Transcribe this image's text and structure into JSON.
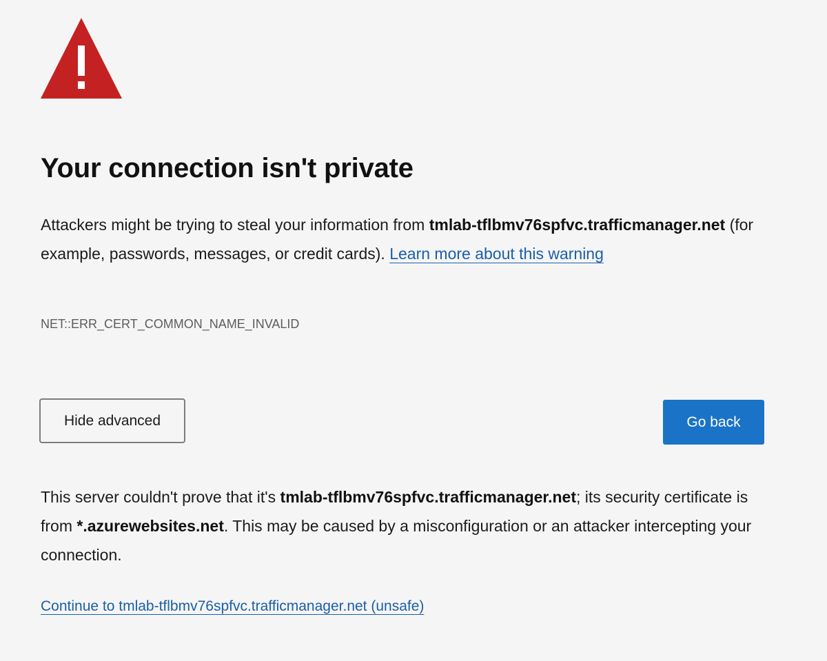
{
  "colors": {
    "background": "#f5f5f5",
    "warning_red": "#c42222",
    "link_blue": "#1a5fa8",
    "primary_button": "#1a73c7"
  },
  "icon": {
    "name": "warning-triangle-icon"
  },
  "title": "Your connection isn't private",
  "description": {
    "prefix": "Attackers might be trying to steal your information from ",
    "host": "tmlab-tflbmv76spfvc.trafficmanager.net",
    "suffix": " (for example, passwords, messages, or credit cards). ",
    "learn_more_link": "Learn more about this warning"
  },
  "error_code": "NET::ERR_CERT_COMMON_NAME_INVALID",
  "buttons": {
    "hide_advanced": "Hide advanced",
    "go_back": "Go back"
  },
  "details": {
    "part1": "This server couldn't prove that it's ",
    "host": "tmlab-tflbmv76spfvc.trafficmanager.net",
    "part2": "; its security certificate is from ",
    "cert_domain": "*.azurewebsites.net",
    "part3": ". This may be caused by a misconfiguration or an attacker intercepting your connection."
  },
  "proceed_link": "Continue to tmlab-tflbmv76spfvc.trafficmanager.net (unsafe)"
}
